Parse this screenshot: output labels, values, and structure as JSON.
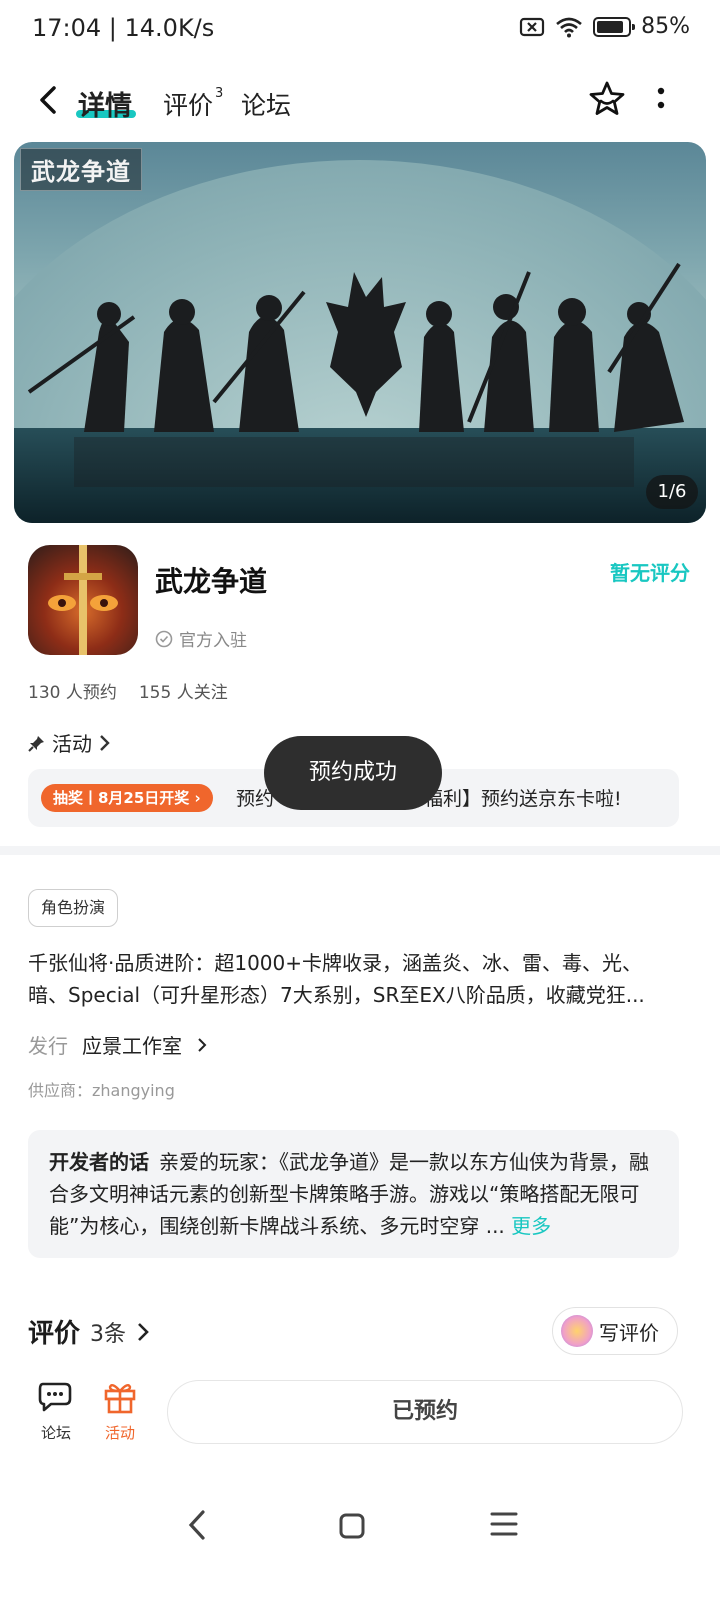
{
  "status_bar": {
    "time": "17:04 | 14.0K/s",
    "battery": "85%"
  },
  "header": {
    "tabs": [
      {
        "label": "详情"
      },
      {
        "label": "评价",
        "badge": "3"
      },
      {
        "label": "论坛"
      }
    ]
  },
  "banner": {
    "logo_text": "武龙争道",
    "counter": "1/6"
  },
  "app": {
    "name": "武龙争道",
    "official": "官方入驻",
    "rating": "暂无评分",
    "reservations": "130 人预约",
    "followers": "155 人关注"
  },
  "activity": {
    "title": "活动",
    "badge": "抽奖丨8月25日开奖 ›",
    "text_left": "预约",
    "text_right": "福利】预约送京东卡啦!"
  },
  "toast": "预约成功",
  "tag": "角色扮演",
  "description": "千张仙将·品质进阶：超1000+卡牌收录，涵盖炎、冰、雷、毒、光、暗、Special（可升星形态）7大系别，SR至EX八阶品质，收藏党狂...",
  "publisher": {
    "label": "发行",
    "value": "应景工作室"
  },
  "supplier": "供应商：zhangying",
  "developer_note": {
    "title": "开发者的话",
    "text": "亲爱的玩家：《武龙争道》是一款以东方仙侠为背景，融合多文明神话元素的创新型卡牌策略手游。游戏以“策略搭配无限可能”为核心，围绕创新卡牌战斗系统、多元时空穿 ... ",
    "more": "更多"
  },
  "reviews": {
    "title": "评价",
    "count": "3条",
    "write_button": "写评价"
  },
  "bottom_bar": {
    "forum": "论坛",
    "activity": "活动",
    "reserved_button": "已预约"
  },
  "colors": {
    "accent": "#19c7c1",
    "orange": "#f0662c"
  }
}
